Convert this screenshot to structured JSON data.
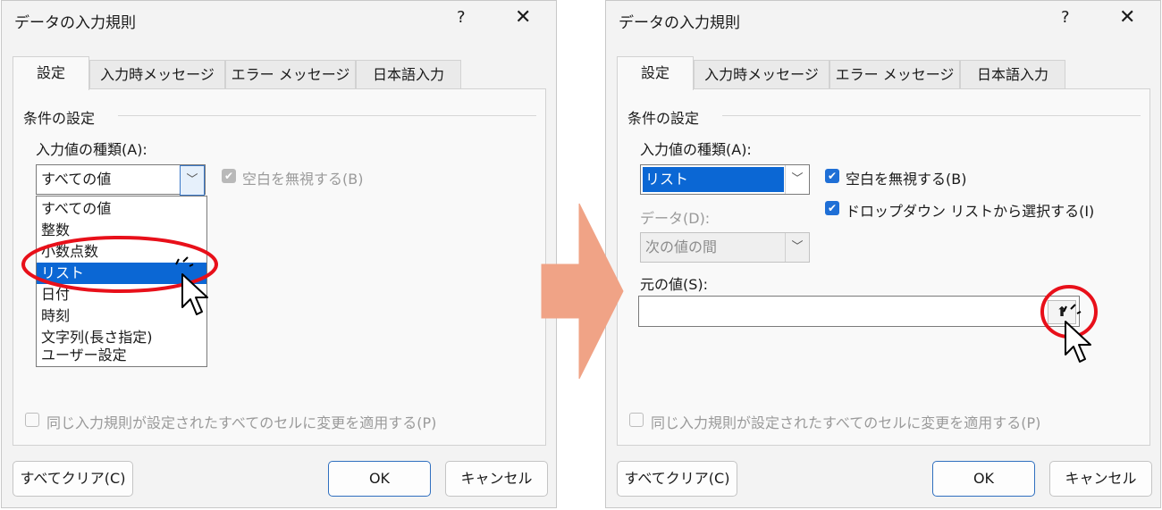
{
  "dialog": {
    "title": "データの入力規則",
    "help": "?",
    "close": "✕",
    "tabs": [
      "設定",
      "入力時メッセージ",
      "エラー メッセージ",
      "日本語入力"
    ],
    "group_label": "条件の設定",
    "allow_label": "入力値の種類(A):",
    "ignore_blank_label": "空白を無視する(B)",
    "apply_all_label": "同じ入力規則が設定されたすべてのセルに変更を適用する(P)",
    "clear_all": "すべてクリア(C)",
    "ok": "OK",
    "cancel": "キャンセル"
  },
  "left": {
    "allow_value": "すべての値",
    "dropdown_options": [
      "すべての値",
      "整数",
      "小数点数",
      "リスト",
      "日付",
      "時刻",
      "文字列(長さ指定)",
      "ユーザー設定"
    ],
    "selected_option": "リスト"
  },
  "right": {
    "allow_value": "リスト",
    "data_label": "データ(D):",
    "data_value": "次の値の間",
    "in_cell_dropdown_label": "ドロップダウン リストから選択する(I)",
    "source_label": "元の値(S):",
    "source_value": ""
  },
  "colors": {
    "accent": "#0b67d4",
    "highlight_circle": "#e8101a",
    "arrow": "#f0a386"
  },
  "icons": [
    "chevron-down-icon",
    "checkbox-icon",
    "collapse-dialog-icon",
    "mouse-pointer-icon",
    "arrow-right-icon"
  ]
}
